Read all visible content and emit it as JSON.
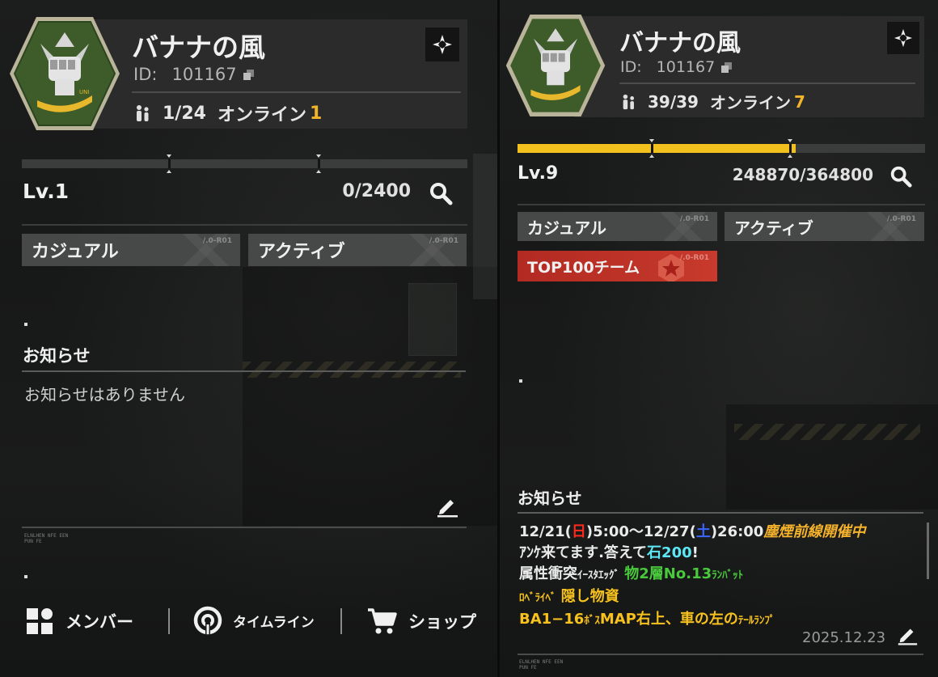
{
  "left": {
    "team_name": "バナナの風",
    "id_label": "ID:",
    "id_value": "101167",
    "members": "1/24",
    "online_label": "オンライン",
    "online_count": "1",
    "level": "Lv.1",
    "xp": "0/2400",
    "xp_progress": 0.0,
    "tags": [
      {
        "label": "カジュアル",
        "code": "/.0-R01"
      },
      {
        "label": "アクティブ",
        "code": "/.0-R01"
      }
    ],
    "notice_title": "お知らせ",
    "notice_empty": "お知らせはありません",
    "footer_small": "ELNLHEN NFE EEN",
    "footer_small2": "PUN FE",
    "nav": [
      {
        "label": "メンバー",
        "icon": "members-grid-icon"
      },
      {
        "label": "タイムライン",
        "icon": "timeline-icon"
      },
      {
        "label": "ショップ",
        "icon": "cart-icon"
      }
    ]
  },
  "right": {
    "team_name": "バナナの風",
    "id_label": "ID:",
    "id_value": "101167",
    "members": "39/39",
    "online_label": "オンライン",
    "online_count": "7",
    "level": "Lv.9",
    "xp": "248870/364800",
    "xp_progress": 0.682,
    "tags": [
      {
        "label": "カジュアル",
        "code": "/.0-R01"
      },
      {
        "label": "アクティブ",
        "code": "/.0-R01"
      },
      {
        "label": "TOP100チーム",
        "code": "/.0-R01"
      }
    ],
    "notice_title": "お知らせ",
    "notice_lines": {
      "l1_a": "12/21(",
      "l1_b": "日",
      "l1_c": ")5:00〜12/27(",
      "l1_d": "土",
      "l1_e": ")26:00",
      "l1_f": "塵煙前線開催中",
      "l2_a": "ｱﾝｹ来てます.答えて",
      "l2_b": "石200",
      "l2_c": "!",
      "l3_a": "属性衝突",
      "l3_b": "ｲｰｽﾀｴｯｸﾞ",
      "l3_c": "物2層No.13",
      "l3_d": "ﾗﾝﾊﾞｯﾄ",
      "l4_a": "ﾛﾍﾞﾗｲﾍﾞ",
      "l4_b": "隠し物資",
      "l5_a": "BA1−16",
      "l5_b": "ﾎﾞｽ",
      "l5_c": "MAP右上、車の左の",
      "l5_d": "ﾃｰﾙﾗﾝﾌﾟ"
    },
    "notice_date": "2025.12.23",
    "footer_small": "ELNLHEN NFE EEN",
    "footer_small2": "PUN FE"
  },
  "colors": {
    "accent_yellow": "#f3c11e",
    "online_orange": "#f2b52a",
    "tag_red": "#c73a2c",
    "emblem_green": "#3f5e2a"
  }
}
